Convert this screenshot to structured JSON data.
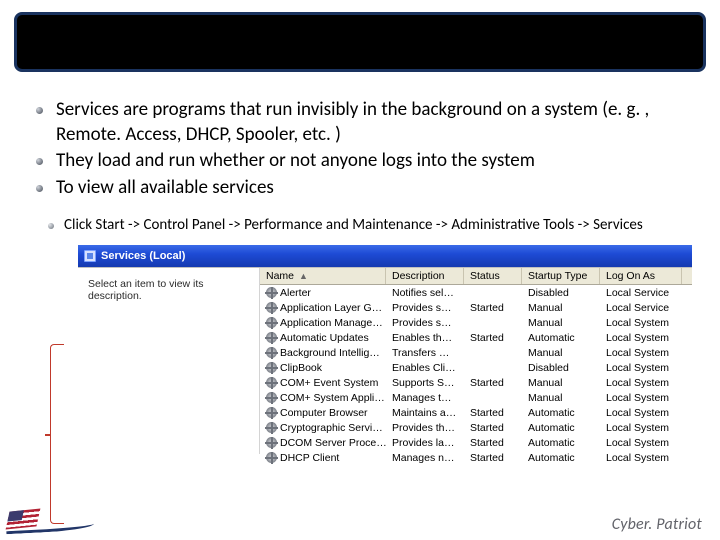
{
  "bullets": [
    "Services are programs that run invisibly in the background on a system  (e. g. , Remote. Access, DHCP, Spooler, etc. )",
    "They load and run whether or not anyone logs into the system",
    "To view all available services"
  ],
  "sub_bullet": "Click Start -> Control Panel -> Performance and Maintenance -> Administrative Tools -> Services",
  "services_window": {
    "title": "Services (Local)",
    "left_hint": "Select an item to view its description.",
    "columns": {
      "name": "Name",
      "description": "Description",
      "status": "Status",
      "startup": "Startup Type",
      "logon": "Log On As"
    },
    "rows": [
      {
        "name": "Alerter",
        "desc": "Notifies sel…",
        "status": "",
        "startup": "Disabled",
        "logon": "Local Service"
      },
      {
        "name": "Application Layer G…",
        "desc": "Provides s…",
        "status": "Started",
        "startup": "Manual",
        "logon": "Local Service"
      },
      {
        "name": "Application Manage…",
        "desc": "Provides s…",
        "status": "",
        "startup": "Manual",
        "logon": "Local System"
      },
      {
        "name": "Automatic Updates",
        "desc": "Enables th…",
        "status": "Started",
        "startup": "Automatic",
        "logon": "Local System"
      },
      {
        "name": "Background Intellig…",
        "desc": "Transfers …",
        "status": "",
        "startup": "Manual",
        "logon": "Local System"
      },
      {
        "name": "ClipBook",
        "desc": "Enables Cli…",
        "status": "",
        "startup": "Disabled",
        "logon": "Local System"
      },
      {
        "name": "COM+ Event System",
        "desc": "Supports S…",
        "status": "Started",
        "startup": "Manual",
        "logon": "Local System"
      },
      {
        "name": "COM+ System Appli…",
        "desc": "Manages t…",
        "status": "",
        "startup": "Manual",
        "logon": "Local System"
      },
      {
        "name": "Computer Browser",
        "desc": "Maintains a…",
        "status": "Started",
        "startup": "Automatic",
        "logon": "Local System"
      },
      {
        "name": "Cryptographic Servi…",
        "desc": "Provides th…",
        "status": "Started",
        "startup": "Automatic",
        "logon": "Local System"
      },
      {
        "name": "DCOM Server Proce…",
        "desc": "Provides la…",
        "status": "Started",
        "startup": "Automatic",
        "logon": "Local System"
      },
      {
        "name": "DHCP Client",
        "desc": "Manages n…",
        "status": "Started",
        "startup": "Automatic",
        "logon": "Local System"
      }
    ]
  },
  "brand": "Cyber. Patriot"
}
